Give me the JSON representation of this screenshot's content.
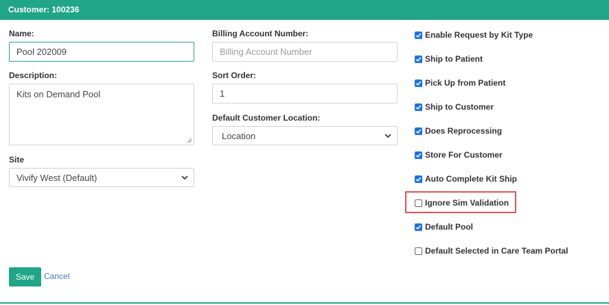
{
  "header": {
    "title": "Customer: 100236"
  },
  "form": {
    "name_label": "Name:",
    "name_value": "Pool 202009",
    "description_label": "Description:",
    "description_value": "Kits on Demand Pool",
    "site_label": "Site",
    "site_value": "Vivify West (Default)",
    "billing_label": "Billing Account Number:",
    "billing_placeholder": "Billing Account Number",
    "sort_label": "Sort Order:",
    "sort_value": "1",
    "location_label": "Default Customer Location:",
    "location_value": "Location"
  },
  "options": [
    {
      "label": "Enable Request by Kit Type",
      "checked": true
    },
    {
      "label": "Ship to Patient",
      "checked": true
    },
    {
      "label": "Pick Up from Patient",
      "checked": true
    },
    {
      "label": "Ship to Customer",
      "checked": true
    },
    {
      "label": "Does Reprocessing",
      "checked": true
    },
    {
      "label": "Store For Customer",
      "checked": true
    },
    {
      "label": "Auto Complete Kit Ship",
      "checked": true
    },
    {
      "label": "Ignore Sim Validation",
      "checked": false
    },
    {
      "label": "Default Pool",
      "checked": true
    },
    {
      "label": "Default Selected in Care Team Portal",
      "checked": false
    }
  ],
  "actions": {
    "save_label": "Save",
    "cancel_label": "Cancel"
  },
  "colors": {
    "accent": "#21a588",
    "checkbox": "#1a73e8",
    "highlight": "#e05252"
  }
}
